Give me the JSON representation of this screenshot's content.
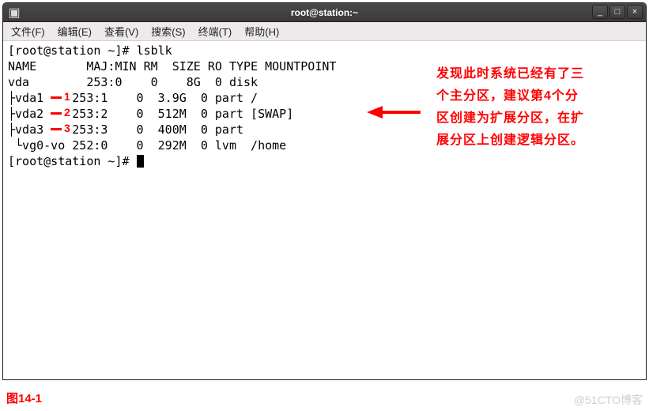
{
  "window": {
    "title": "root@station:~"
  },
  "menu": {
    "file": "文件(F)",
    "edit": "编辑(E)",
    "view": "查看(V)",
    "search": "搜索(S)",
    "terminal": "终端(T)",
    "help": "帮助(H)"
  },
  "terminal": {
    "prompt1": "[root@station ~]# ",
    "cmd1": "lsblk",
    "header": "NAME       MAJ:MIN RM  SIZE RO TYPE MOUNTPOINT",
    "rows": [
      "vda        253:0    0    8G  0 disk",
      "├vda1    253:1    0  3.9G  0 part /",
      "├vda2    253:2    0  512M  0 part [SWAP]",
      "├vda3    253:3    0  400M  0 part",
      " └vg0-vo 252:0    0  292M  0 lvm  /home"
    ],
    "prompt2": "[root@station ~]# "
  },
  "annotations": {
    "num1": "1",
    "num2": "2",
    "num3": "3",
    "note": "发现此时系统已经有了三个主分区，建议第4个分区创建为扩展分区，在扩展分区上创建逻辑分区。"
  },
  "figure_label": "图14-1",
  "watermark": "@51CTO博客",
  "icons": {
    "terminal_glyph": "▣",
    "minimize": "_",
    "maximize": "□",
    "close": "×"
  }
}
